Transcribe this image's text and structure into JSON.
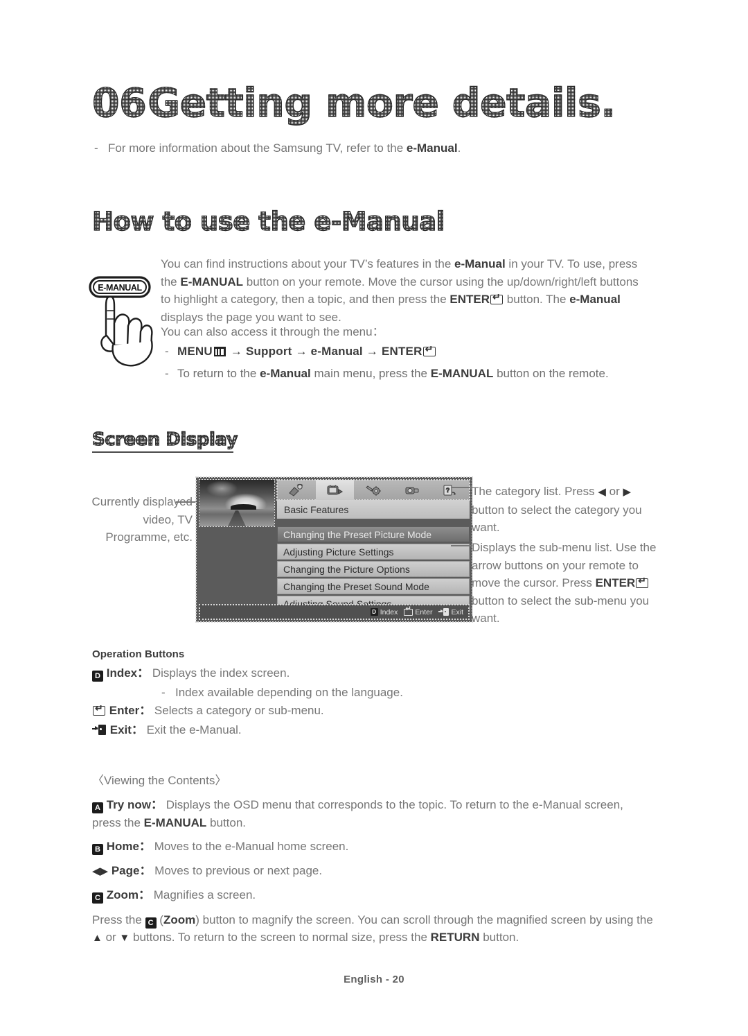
{
  "chapter": {
    "number": "06",
    "title": "Getting more details.",
    "note_dash": "-",
    "note_pre": "For more information about the Samsung TV, refer to the ",
    "note_bold": "e-Manual",
    "note_post": "."
  },
  "section_emanual": {
    "heading": "How to use the e-Manual",
    "illustration_label": "E-MANUAL",
    "intro": {
      "t1": "You can find instructions about your TV’s features in the ",
      "b1": "e-Manual",
      "t2": " in your TV. To use, press the ",
      "b2": "E-MANUAL",
      "t3": " button on your remote. Move the cursor using the up/down/right/left buttons to highlight a category, then a topic, and then press the ",
      "b3": "ENTER",
      "t4": " button. The ",
      "b4": "e-Manual",
      "t5": " displays the page you want to see."
    },
    "menu_access_line": "You can also access it through the menu：",
    "menu_path": {
      "dash": "-",
      "p1": "MENU",
      "arrow1": "→",
      "p2": "Support",
      "arrow2": "→",
      "p3": "e-Manual",
      "arrow3": "→",
      "p4": "ENTER"
    },
    "return_note": {
      "dash": "-",
      "t1": "To return to the ",
      "b1": "e-Manual",
      "t2": " main menu, press the ",
      "b2": "E-MANUAL",
      "t3": " button on the remote."
    }
  },
  "section_screen_display": {
    "heading": "Screen Display",
    "left_annotation": "Currently displayed video, TV Programme, etc.",
    "right_annotation_1": {
      "t1": "The category list. Press ",
      "icon_left": "◀",
      "t2": " or ",
      "icon_right": "▶",
      "t3": " button to select the category you want."
    },
    "right_annotation_2": {
      "t1": "Displays the sub-menu list. Use the arrow buttons on your remote to move the cursor. Press ",
      "b1": "ENTER",
      "t2": " button to select the sub-menu you want."
    },
    "tv": {
      "category_label": "Basic Features",
      "categories": [
        {
          "name": "channel-icon",
          "selected": false
        },
        {
          "name": "picture-tv-icon",
          "selected": true
        },
        {
          "name": "settings-icon",
          "selected": false
        },
        {
          "name": "media-icon",
          "selected": false
        },
        {
          "name": "support-icon",
          "selected": false
        }
      ],
      "submenu": [
        {
          "label": "Changing the Preset Picture Mode",
          "selected": true
        },
        {
          "label": "Adjusting Picture Settings",
          "selected": false
        },
        {
          "label": "Changing the Picture Options",
          "selected": false
        },
        {
          "label": "Changing the Preset Sound Mode",
          "selected": false
        },
        {
          "label": "Adjusting Sound Settings",
          "selected": false
        }
      ],
      "status_bar": {
        "index_key": "D",
        "index_label": "Index",
        "enter_label": "Enter",
        "exit_label": "Exit"
      }
    }
  },
  "operation_buttons": {
    "heading": "Operation Buttons",
    "index": {
      "key": "D",
      "label": "Index",
      "sep": "：",
      "desc": " Displays the index screen."
    },
    "index_note": {
      "dash": "-",
      "text": "Index available depending on the language."
    },
    "enter": {
      "label": "Enter",
      "sep": "：",
      "desc": " Selects a category or sub-menu."
    },
    "exit": {
      "label": "Exit",
      "sep": "：",
      "desc": " Exit the e-Manual."
    }
  },
  "viewing_contents": {
    "heading": "〈Viewing the Contents〉",
    "try_now": {
      "key": "A",
      "label": "Try now",
      "sep": "：",
      "t1": " Displays the OSD menu that corresponds to the topic. To return to the e-Manual screen, press the ",
      "b1": "E-MANUAL",
      "t2": " button."
    },
    "home": {
      "key": "B",
      "label": "Home",
      "sep": "：",
      "desc": " Moves to the e-Manual home screen."
    },
    "page": {
      "icons": "◀▶",
      "label": "Page",
      "sep": "：",
      "desc": " Moves to previous or next page."
    },
    "zoom": {
      "key": "C",
      "label": "Zoom",
      "sep": "：",
      "desc": " Magnifies a screen."
    },
    "zoom_para": {
      "t1": "Press the ",
      "key": "C",
      "t2": " (",
      "b1": "Zoom",
      "t3": ") button to magnify the screen. You can scroll through the magnified screen by using the ",
      "up": "▲",
      "t4": " or ",
      "down": "▼",
      "t5": " buttons. To return to the screen to normal size, press the ",
      "b2": "RETURN",
      "t6": " button."
    }
  },
  "footer": "English - 20"
}
